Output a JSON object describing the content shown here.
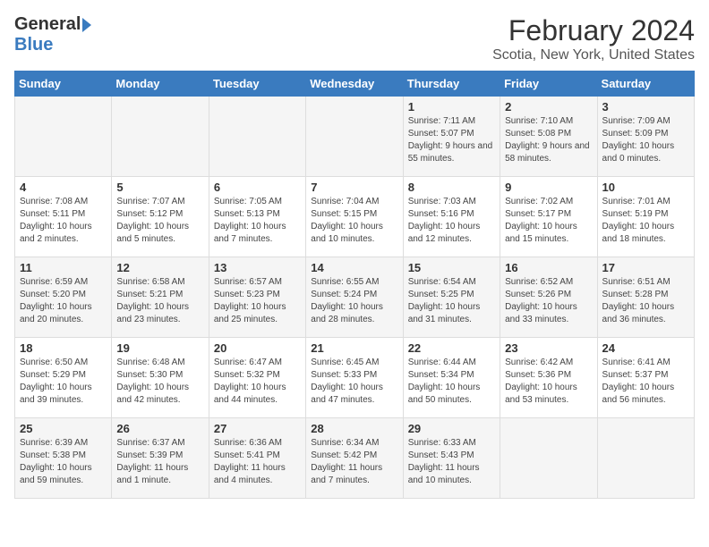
{
  "header": {
    "logo_general": "General",
    "logo_blue": "Blue",
    "title": "February 2024",
    "subtitle": "Scotia, New York, United States"
  },
  "days_of_week": [
    "Sunday",
    "Monday",
    "Tuesday",
    "Wednesday",
    "Thursday",
    "Friday",
    "Saturday"
  ],
  "weeks": [
    [
      {
        "day": "",
        "info": ""
      },
      {
        "day": "",
        "info": ""
      },
      {
        "day": "",
        "info": ""
      },
      {
        "day": "",
        "info": ""
      },
      {
        "day": "1",
        "info": "Sunrise: 7:11 AM\nSunset: 5:07 PM\nDaylight: 9 hours and 55 minutes."
      },
      {
        "day": "2",
        "info": "Sunrise: 7:10 AM\nSunset: 5:08 PM\nDaylight: 9 hours and 58 minutes."
      },
      {
        "day": "3",
        "info": "Sunrise: 7:09 AM\nSunset: 5:09 PM\nDaylight: 10 hours and 0 minutes."
      }
    ],
    [
      {
        "day": "4",
        "info": "Sunrise: 7:08 AM\nSunset: 5:11 PM\nDaylight: 10 hours and 2 minutes."
      },
      {
        "day": "5",
        "info": "Sunrise: 7:07 AM\nSunset: 5:12 PM\nDaylight: 10 hours and 5 minutes."
      },
      {
        "day": "6",
        "info": "Sunrise: 7:05 AM\nSunset: 5:13 PM\nDaylight: 10 hours and 7 minutes."
      },
      {
        "day": "7",
        "info": "Sunrise: 7:04 AM\nSunset: 5:15 PM\nDaylight: 10 hours and 10 minutes."
      },
      {
        "day": "8",
        "info": "Sunrise: 7:03 AM\nSunset: 5:16 PM\nDaylight: 10 hours and 12 minutes."
      },
      {
        "day": "9",
        "info": "Sunrise: 7:02 AM\nSunset: 5:17 PM\nDaylight: 10 hours and 15 minutes."
      },
      {
        "day": "10",
        "info": "Sunrise: 7:01 AM\nSunset: 5:19 PM\nDaylight: 10 hours and 18 minutes."
      }
    ],
    [
      {
        "day": "11",
        "info": "Sunrise: 6:59 AM\nSunset: 5:20 PM\nDaylight: 10 hours and 20 minutes."
      },
      {
        "day": "12",
        "info": "Sunrise: 6:58 AM\nSunset: 5:21 PM\nDaylight: 10 hours and 23 minutes."
      },
      {
        "day": "13",
        "info": "Sunrise: 6:57 AM\nSunset: 5:23 PM\nDaylight: 10 hours and 25 minutes."
      },
      {
        "day": "14",
        "info": "Sunrise: 6:55 AM\nSunset: 5:24 PM\nDaylight: 10 hours and 28 minutes."
      },
      {
        "day": "15",
        "info": "Sunrise: 6:54 AM\nSunset: 5:25 PM\nDaylight: 10 hours and 31 minutes."
      },
      {
        "day": "16",
        "info": "Sunrise: 6:52 AM\nSunset: 5:26 PM\nDaylight: 10 hours and 33 minutes."
      },
      {
        "day": "17",
        "info": "Sunrise: 6:51 AM\nSunset: 5:28 PM\nDaylight: 10 hours and 36 minutes."
      }
    ],
    [
      {
        "day": "18",
        "info": "Sunrise: 6:50 AM\nSunset: 5:29 PM\nDaylight: 10 hours and 39 minutes."
      },
      {
        "day": "19",
        "info": "Sunrise: 6:48 AM\nSunset: 5:30 PM\nDaylight: 10 hours and 42 minutes."
      },
      {
        "day": "20",
        "info": "Sunrise: 6:47 AM\nSunset: 5:32 PM\nDaylight: 10 hours and 44 minutes."
      },
      {
        "day": "21",
        "info": "Sunrise: 6:45 AM\nSunset: 5:33 PM\nDaylight: 10 hours and 47 minutes."
      },
      {
        "day": "22",
        "info": "Sunrise: 6:44 AM\nSunset: 5:34 PM\nDaylight: 10 hours and 50 minutes."
      },
      {
        "day": "23",
        "info": "Sunrise: 6:42 AM\nSunset: 5:36 PM\nDaylight: 10 hours and 53 minutes."
      },
      {
        "day": "24",
        "info": "Sunrise: 6:41 AM\nSunset: 5:37 PM\nDaylight: 10 hours and 56 minutes."
      }
    ],
    [
      {
        "day": "25",
        "info": "Sunrise: 6:39 AM\nSunset: 5:38 PM\nDaylight: 10 hours and 59 minutes."
      },
      {
        "day": "26",
        "info": "Sunrise: 6:37 AM\nSunset: 5:39 PM\nDaylight: 11 hours and 1 minute."
      },
      {
        "day": "27",
        "info": "Sunrise: 6:36 AM\nSunset: 5:41 PM\nDaylight: 11 hours and 4 minutes."
      },
      {
        "day": "28",
        "info": "Sunrise: 6:34 AM\nSunset: 5:42 PM\nDaylight: 11 hours and 7 minutes."
      },
      {
        "day": "29",
        "info": "Sunrise: 6:33 AM\nSunset: 5:43 PM\nDaylight: 11 hours and 10 minutes."
      },
      {
        "day": "",
        "info": ""
      },
      {
        "day": "",
        "info": ""
      }
    ]
  ]
}
